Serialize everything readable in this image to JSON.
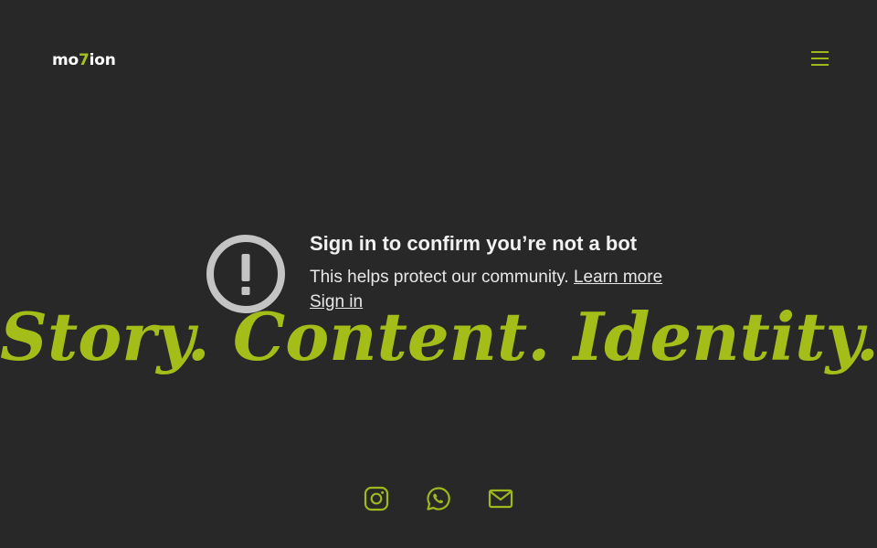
{
  "header": {
    "logo": {
      "prefix": "mo",
      "accent": "7",
      "suffix": "ion"
    },
    "menu_icon": "hamburger-menu-icon"
  },
  "hero": {
    "tagline": "Story. Content. Identity."
  },
  "video_notice": {
    "icon": "warning-icon",
    "title": "Sign in to confirm you’re not a bot",
    "body": "This helps protect our community.",
    "learn_more": "Learn more",
    "sign_in": "Sign in"
  },
  "footer": {
    "social": [
      "instagram-icon",
      "whatsapp-icon",
      "email-icon"
    ]
  },
  "colors": {
    "background": "#282828",
    "accent": "#a4bd19",
    "icon_gray": "#c4c4c4",
    "text": "#f1f1f1"
  }
}
